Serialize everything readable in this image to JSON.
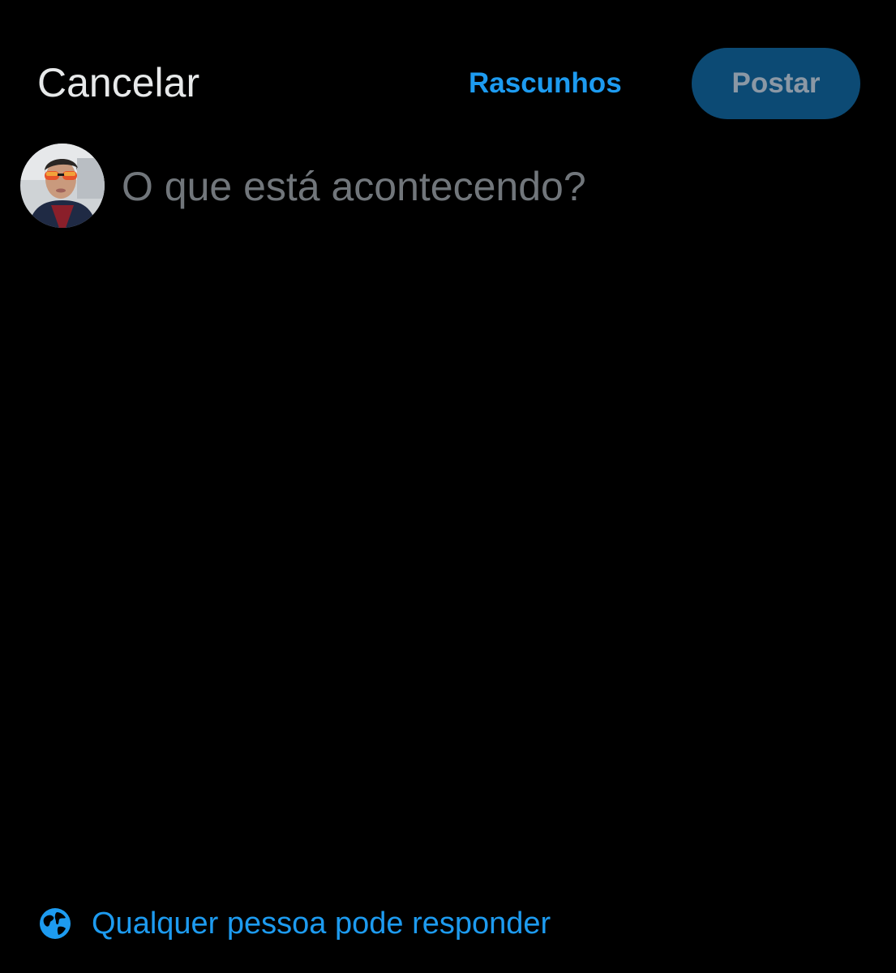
{
  "header": {
    "cancel_label": "Cancelar",
    "drafts_label": "Rascunhos",
    "post_label": "Postar"
  },
  "composer": {
    "placeholder": "O que está acontecendo?",
    "value": "",
    "avatar_icon": "user-avatar"
  },
  "reply_settings": {
    "label": "Qualquer pessoa pode responder",
    "icon": "globe-icon"
  },
  "colors": {
    "background": "#000000",
    "accent": "#1d9bf0",
    "post_button_disabled_bg": "#0c4a74",
    "post_button_disabled_text": "#8b98a5",
    "placeholder": "#71767b",
    "text": "#e7e9ea"
  }
}
